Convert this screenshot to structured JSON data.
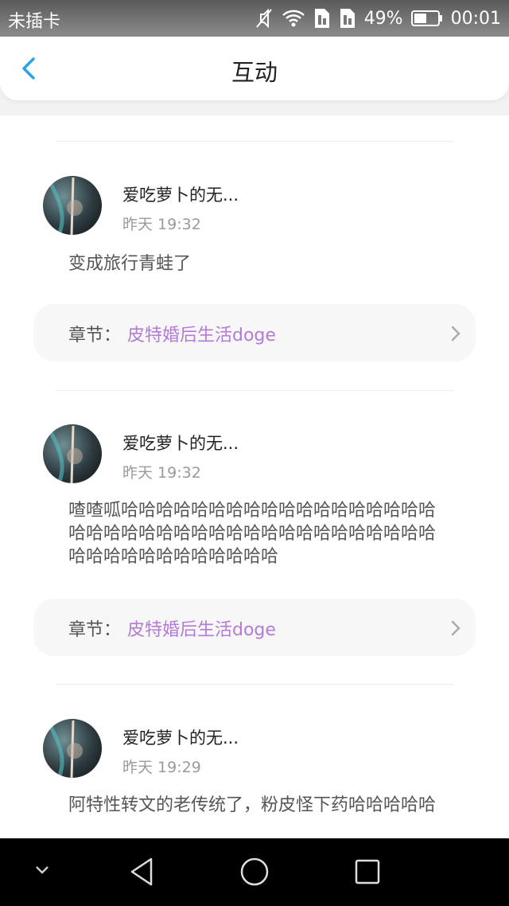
{
  "status_bar": {
    "carrier": "未插卡",
    "battery_percent": "49%",
    "time": "00:01",
    "icons": [
      "mute-icon",
      "wifi-icon",
      "sim1-icon",
      "sim2-icon",
      "battery-icon"
    ]
  },
  "header": {
    "title": "互动",
    "back_icon": "chevron-left-icon"
  },
  "colors": {
    "accent": "#2aa3e6",
    "chapter_link": "#b57ad8"
  },
  "comments": [
    {
      "username": "爱吃萝卜的无...",
      "time": "昨天 19:32",
      "text": "变成旅行青蛙了",
      "chapter_label": "章节：",
      "chapter_title": "皮特婚后生活doge"
    },
    {
      "username": "爱吃萝卜的无...",
      "time": "昨天 19:32",
      "text": "喳喳呱哈哈哈哈哈哈哈哈哈哈哈哈哈哈哈哈哈哈哈哈哈哈哈哈哈哈哈哈哈哈哈哈哈哈哈哈哈哈哈哈哈哈哈哈哈哈哈哈哈哈哈",
      "chapter_label": "章节：",
      "chapter_title": "皮特婚后生活doge"
    },
    {
      "username": "爱吃萝卜的无...",
      "time": "昨天 19:29",
      "text": "阿特性转文的老传统了，粉皮怪下药哈哈哈哈哈"
    }
  ],
  "nav_bar": {
    "icons": [
      "hide-keyboard-icon",
      "back-triangle-icon",
      "home-circle-icon",
      "recents-square-icon"
    ]
  }
}
